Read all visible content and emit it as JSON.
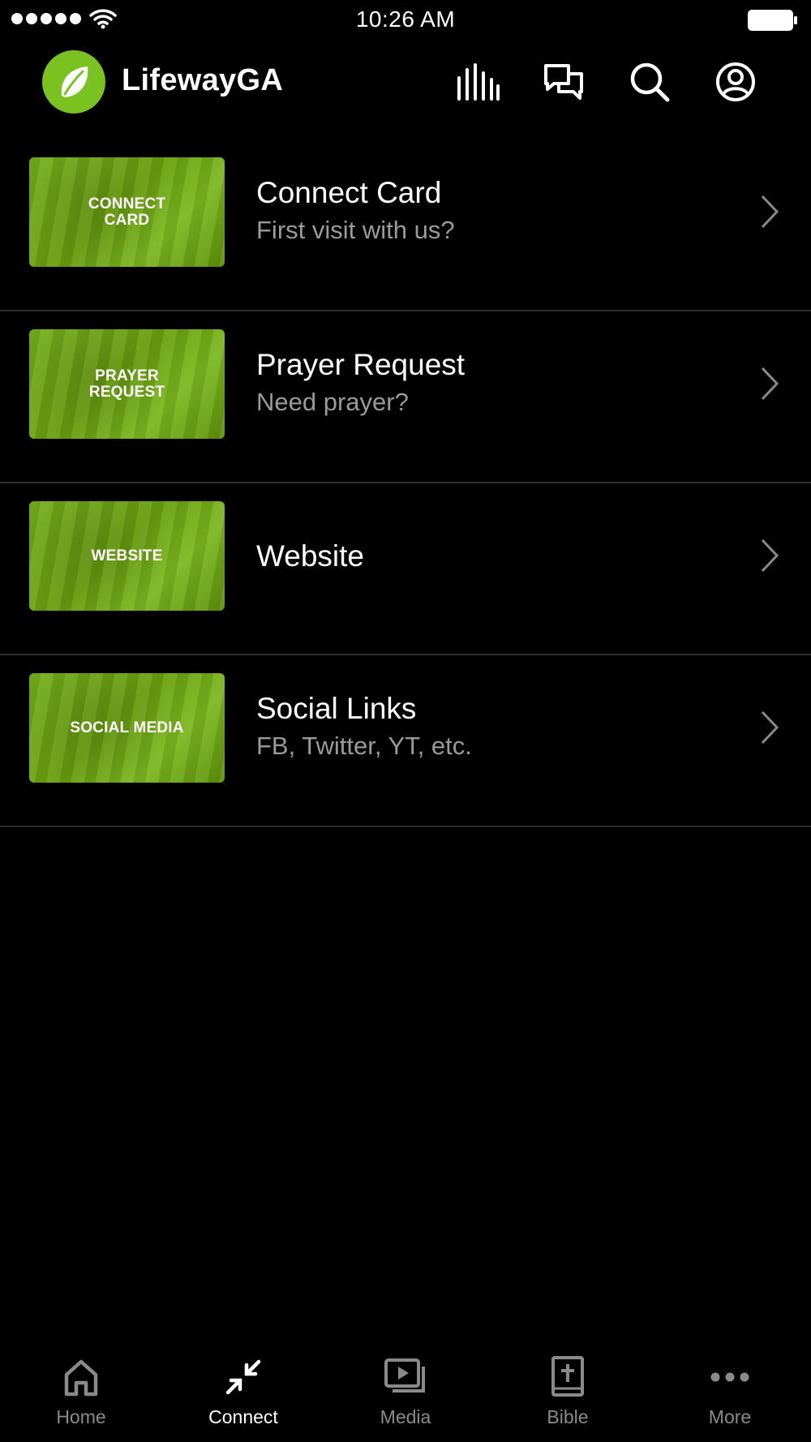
{
  "status_bar": {
    "time": "10:26 AM",
    "icons": [
      "signal-dots-icon",
      "wifi-icon",
      "battery-icon"
    ]
  },
  "header": {
    "app_name": "LifewayGA",
    "logo_icon": "leaf-icon",
    "logo_color": "#79c21f",
    "actions": [
      "audio-bars-icon",
      "chat-bubbles-icon",
      "search-icon",
      "account-icon"
    ]
  },
  "list": [
    {
      "thumb_text": "CONNECT CARD",
      "title": "Connect Card",
      "subtitle": "First visit with us?"
    },
    {
      "thumb_text": "PRAYER REQUEST",
      "title": "Prayer Request",
      "subtitle": "Need prayer?"
    },
    {
      "thumb_text": "WEBSITE",
      "title": "Website",
      "subtitle": ""
    },
    {
      "thumb_text": "SOCIAL MEDIA",
      "title": "Social Links",
      "subtitle": "FB, Twitter, YT, etc."
    }
  ],
  "tab_bar": {
    "active": "Connect",
    "tabs": [
      {
        "label": "Home",
        "icon": "home-icon"
      },
      {
        "label": "Connect",
        "icon": "connect-arrows-icon"
      },
      {
        "label": "Media",
        "icon": "media-icon"
      },
      {
        "label": "Bible",
        "icon": "bible-icon"
      },
      {
        "label": "More",
        "icon": "more-icon"
      }
    ]
  },
  "colors": {
    "background": "#000000",
    "accent_green": "#79c21f",
    "subtitle_gray": "#9a9a9a",
    "inactive_tab": "#8a8a8a"
  }
}
